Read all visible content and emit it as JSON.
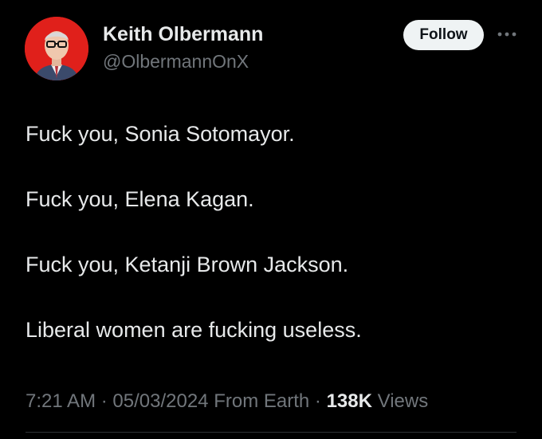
{
  "author": {
    "display_name": "Keith Olbermann",
    "handle": "@OlbermannOnX",
    "avatar_icon": "user-avatar-photo",
    "avatar_bg": "#e0201b"
  },
  "actions": {
    "follow_label": "Follow",
    "more_icon": "more-dots-icon"
  },
  "tweet": {
    "lines": [
      "Fuck you, Sonia Sotomayor.",
      "Fuck you, Elena Kagan.",
      "Fuck you, Ketanji Brown Jackson.",
      "Liberal women are fucking useless."
    ]
  },
  "meta": {
    "time": "7:21 AM",
    "separator": "·",
    "date": "05/03/2024",
    "source": "From Earth",
    "views_count": "138K",
    "views_label": "Views"
  },
  "colors": {
    "background": "#000000",
    "primary_text": "#e7e9ea",
    "secondary_text": "#71767b",
    "button_bg": "#eff3f4"
  }
}
